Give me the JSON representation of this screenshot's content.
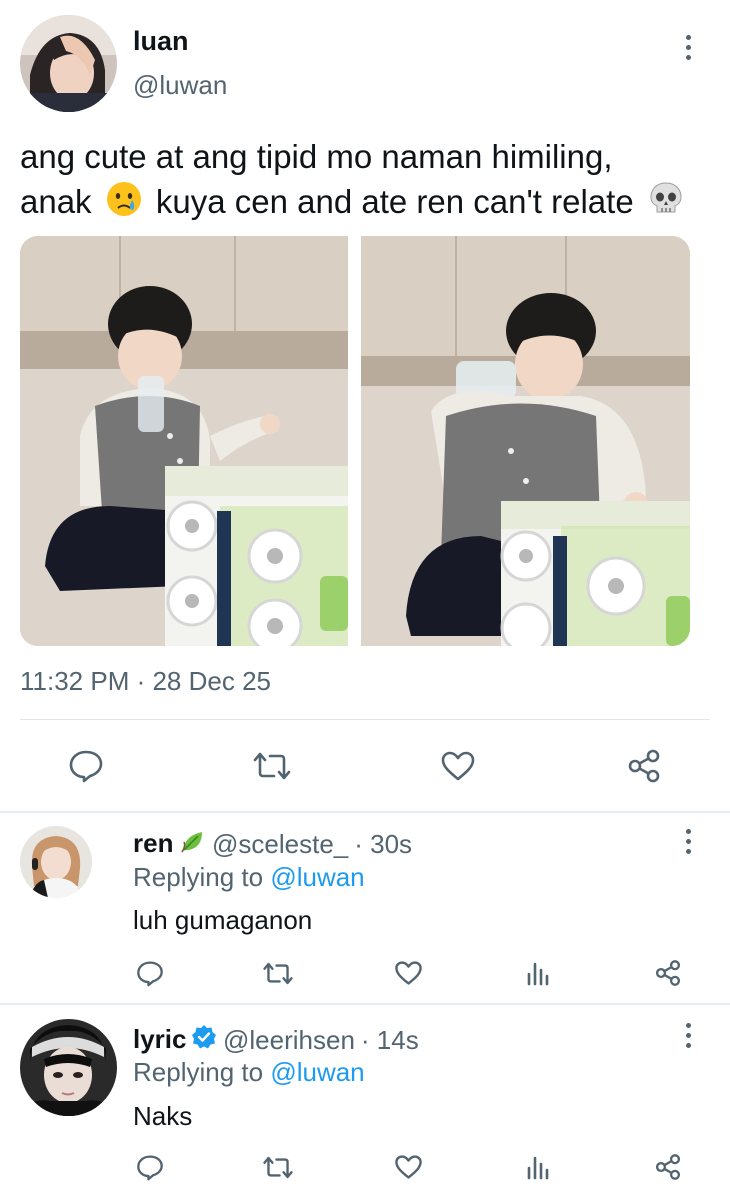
{
  "main_tweet": {
    "author_name": "luan",
    "author_handle": "@luwan",
    "text_line1": "ang cute at ang tipid mo naman himiling,",
    "text_line2_a": "anak",
    "text_line2_b": "kuya cen and ate ren can't relate",
    "emoji_1": "crying-face-emoji",
    "emoji_2": "skull-emoji",
    "timestamp": "11:32 PM · 28 Dec 25",
    "actions": [
      "reply-icon",
      "retweet-icon",
      "like-icon",
      "share-icon"
    ]
  },
  "replies": [
    {
      "name": "ren",
      "name_emoji": "leaf-emoji",
      "handle": "@sceleste_",
      "time": "· 30s",
      "replying_prefix": "Replying to",
      "replying_to": "@luwan",
      "text": "luh gumaganon"
    },
    {
      "name": "lyric",
      "verified": true,
      "handle": "@leerihsen",
      "time": "· 14s",
      "replying_prefix": "Replying to",
      "replying_to": "@luwan",
      "text": "Naks"
    }
  ],
  "colors": {
    "accent": "#1d9bf0",
    "secondary_text": "#536471",
    "divider": "#e1e6ea"
  }
}
